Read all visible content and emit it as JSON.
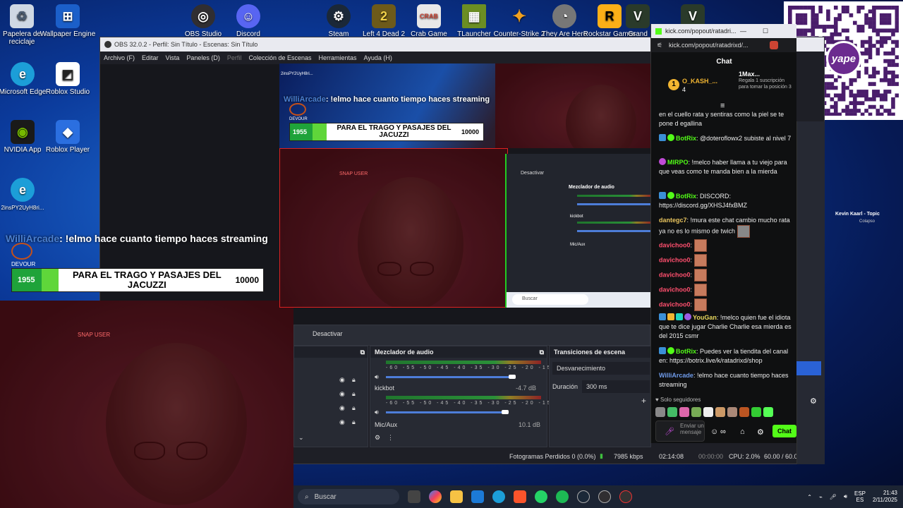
{
  "desktop_icons": [
    {
      "label": "Papelera de reciclaje",
      "icon": "recycle-bin-icon",
      "color": "#cfd8e4"
    },
    {
      "label": "Wallpaper Engine",
      "icon": "wallpaper-engine-icon",
      "color": "#1b5fc9"
    },
    {
      "label": "Microsoft Edge",
      "icon": "edge-icon",
      "color": "#1c9ed8"
    },
    {
      "label": "Roblox Studio",
      "icon": "roblox-studio-icon",
      "color": "#222222"
    },
    {
      "label": "NVIDIA App",
      "icon": "nvidia-icon",
      "color": "#76b900"
    },
    {
      "label": "Roblox Player",
      "icon": "roblox-player-icon",
      "color": "#2b6fe0"
    },
    {
      "label": "2insPY2UyH8ri...",
      "icon": "edge-icon",
      "color": "#1c9ed8"
    },
    {
      "label": "OBS Studio",
      "icon": "obs-icon",
      "color": "#302e31"
    },
    {
      "label": "Discord",
      "icon": "discord-icon",
      "color": "#5865f2"
    },
    {
      "label": "Steam",
      "icon": "steam-icon",
      "color": "#1b2838"
    },
    {
      "label": "Left 4 Dead 2",
      "icon": "l4d2-icon",
      "color": "#6d5a1a"
    },
    {
      "label": "Crab Game",
      "icon": "crab-game-icon",
      "color": "#e8e8e8"
    },
    {
      "label": "TLauncher",
      "icon": "tlauncher-icon",
      "color": "#6b8e23"
    },
    {
      "label": "Counter-Strike 2",
      "icon": "cs2-icon",
      "color": "#f0a020"
    },
    {
      "label": "They Are Here",
      "icon": "they-are-here-icon",
      "color": "#999999"
    },
    {
      "label": "Rockstar Games",
      "icon": "rockstar-icon",
      "color": "#fcaf17"
    },
    {
      "label": "Grand",
      "icon": "gta-icon",
      "color": "#2a3a2a"
    }
  ],
  "obs": {
    "title": "OBS 32.0.2 - Perfil: Sin Título - Escenas: Sin Título",
    "menu": [
      "Archivo (F)",
      "Editar",
      "Vista",
      "Paneles (D)",
      "Perfil",
      "Colección de Escenas",
      "Herramientas",
      "Ayuda (H)"
    ],
    "deactivate_label": "Desactivar",
    "audio_mixer_title": "Mezclador de audio",
    "transitions_title": "Transiciones de escena",
    "transition_value": "Desvanecimiento",
    "duration_label": "Duración",
    "duration_value": "300 ms",
    "mixer_tracks": [
      {
        "name": "kickbot",
        "db": "-4.7 dB"
      },
      {
        "name": "Mic/Aux",
        "db": "10.1 dB"
      }
    ],
    "mixer_scale": "-60 -55 -50 -45 -40 -35 -30 -25 -20 -15 -10 -5 0",
    "status": {
      "dropped_frames": "Fotogramas Perdidos 0 (0.0%)",
      "bitrate": "7985 kbps",
      "live_time": "02:14:08",
      "rec_time": "00:00:00",
      "cpu": "CPU: 2.0%",
      "fps": "60.00 / 60.00 FPS"
    }
  },
  "overlay": {
    "chat_user": "WilliArcade",
    "chat_text": ": !elmo hace cuanto tiempo haces streaming",
    "devour": "DEVOUR",
    "goal_current": "1955",
    "goal_text": "PARA EL TRAGO Y PASAJES DEL JACUZZI",
    "goal_target": "10000",
    "snap": "SNAP USER",
    "source_label": "2insPY2UyH8ri..."
  },
  "kick": {
    "title": "kick.com/popout/ratadri...",
    "url": "kick.com/popout/ratadrixd/...",
    "chat_header": "Chat",
    "top_user": "O_KASH_...",
    "top_count": "4",
    "top_rank": "1",
    "gift_user": "1Max...",
    "gift_text": "Regala 1 suscripción para tomar la posición 3",
    "messages": [
      {
        "user": "",
        "text": "en el cuello rata y sentiras como la piel se te pone d egallina",
        "color": "#eeeeee"
      },
      {
        "user": "BotRix",
        "text": ": @doteroflowx2 subiste al nivel 7",
        "color": "#53fc18"
      },
      {
        "user": "MIRPO",
        "text": ": !melco haber llama a tu viejo para que veas como te manda bien a la mierda",
        "color": "#53fc18"
      },
      {
        "user": "BotRix",
        "text": ": DISCORD: https://discord.gg/XHSJ4fxBMZ",
        "color": "#53fc18"
      },
      {
        "user": "dantegc7",
        "text": ": !mura este chat cambio mucho rata ya no es lo mismo de twich",
        "color": "#e8c45e"
      },
      {
        "user": "davichoo0",
        "text": ":",
        "color": "#ff4f6e"
      },
      {
        "user": "davichoo0",
        "text": ":",
        "color": "#ff4f6e"
      },
      {
        "user": "davichoo0",
        "text": ":",
        "color": "#ff4f6e"
      },
      {
        "user": "davichoo0",
        "text": ":",
        "color": "#ff4f6e"
      },
      {
        "user": "davichoo0",
        "text": ":",
        "color": "#ff4f6e"
      },
      {
        "user": "YouGan",
        "text": ": !melco quien fue el idiota que te dice jugar Charlie Charlie esa mierda es del 2015 csmr",
        "color": "#e8d85e"
      },
      {
        "user": "BotRix",
        "text": ": Puedes ver la tiendita del canal en: https://botrix.live/k/ratadrixd/shop",
        "color": "#53fc18"
      },
      {
        "user": "WilliArcade",
        "text": ": !elmo hace cuanto tiempo haces streaming",
        "color": "#6f9bea"
      }
    ],
    "followers_only": "Solo seguidores",
    "input_placeholder": "Enviar un mensaje",
    "send_label": "Chat"
  },
  "music": {
    "title": "Kevin Kaarl - Topic",
    "subtitle": "Colapso"
  },
  "taskbar": {
    "search_placeholder": "Buscar",
    "lang_top": "ESP",
    "lang_bottom": "ES",
    "time": "21:43",
    "date": "2/11/2025"
  },
  "qr": {
    "brand": "yape"
  },
  "inner_taskbar_search": "Buscar"
}
